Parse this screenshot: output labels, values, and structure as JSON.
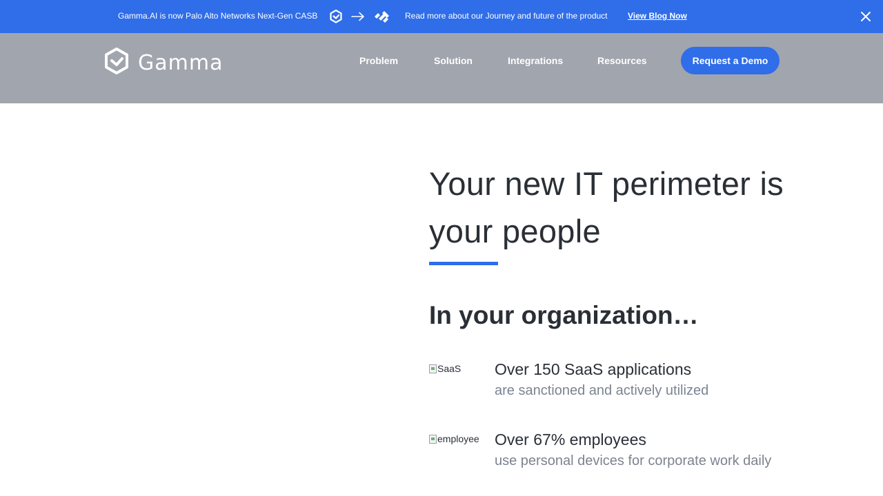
{
  "announcement": {
    "text": "Gamma.AI is now Palo Alto Networks Next-Gen CASB",
    "more_text": "Read more about our Journey and future of the product",
    "link_label": "View Blog Now",
    "icons": [
      "gamma-hex-icon",
      "arrow-right-icon",
      "palo-alto-networks-icon",
      "close-icon"
    ]
  },
  "header": {
    "logo_text": "Gamma",
    "nav": [
      "Problem",
      "Solution",
      "Integrations",
      "Resources"
    ],
    "cta_label": "Request a Demo"
  },
  "main": {
    "headline": "Your new IT perimeter is your people",
    "subheadline": "In your organization…",
    "stats": [
      {
        "img_alt": "SaaS",
        "title": "Over 150 SaaS applications",
        "desc": "are sanctioned and actively utilized"
      },
      {
        "img_alt": "employee",
        "title": "Over 67% employees",
        "desc": "use personal devices for corporate work daily"
      }
    ]
  },
  "colors": {
    "accent": "#2f6de9",
    "header_bg": "#a1a5ad",
    "text_dark": "#2a2f36",
    "text_muted": "#7c8390"
  }
}
